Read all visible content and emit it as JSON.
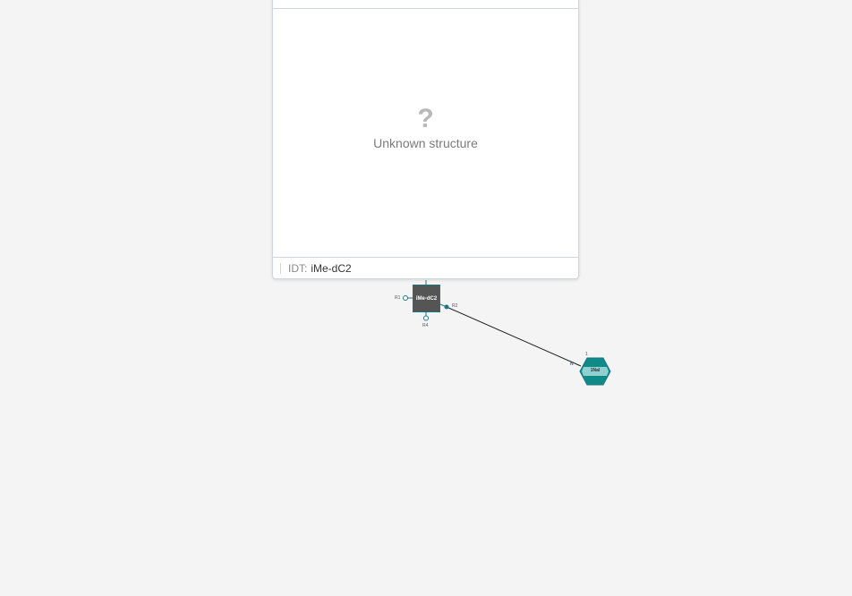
{
  "preview": {
    "question_mark": "?",
    "unknown_text": "Unknown structure",
    "alias_key": "IDT:",
    "alias_value": "iMe-dC2"
  },
  "monomers": {
    "square_label": "iMe-dC2",
    "hex_label": "1Nal",
    "hex_top_mark": "1"
  },
  "attachment_points": {
    "r1": "R1",
    "r2": "R2",
    "r4": "R4",
    "n": "N"
  },
  "colors": {
    "accent": "#167782",
    "hex_fill": "#0f8a87",
    "square_fill": "#555555"
  }
}
